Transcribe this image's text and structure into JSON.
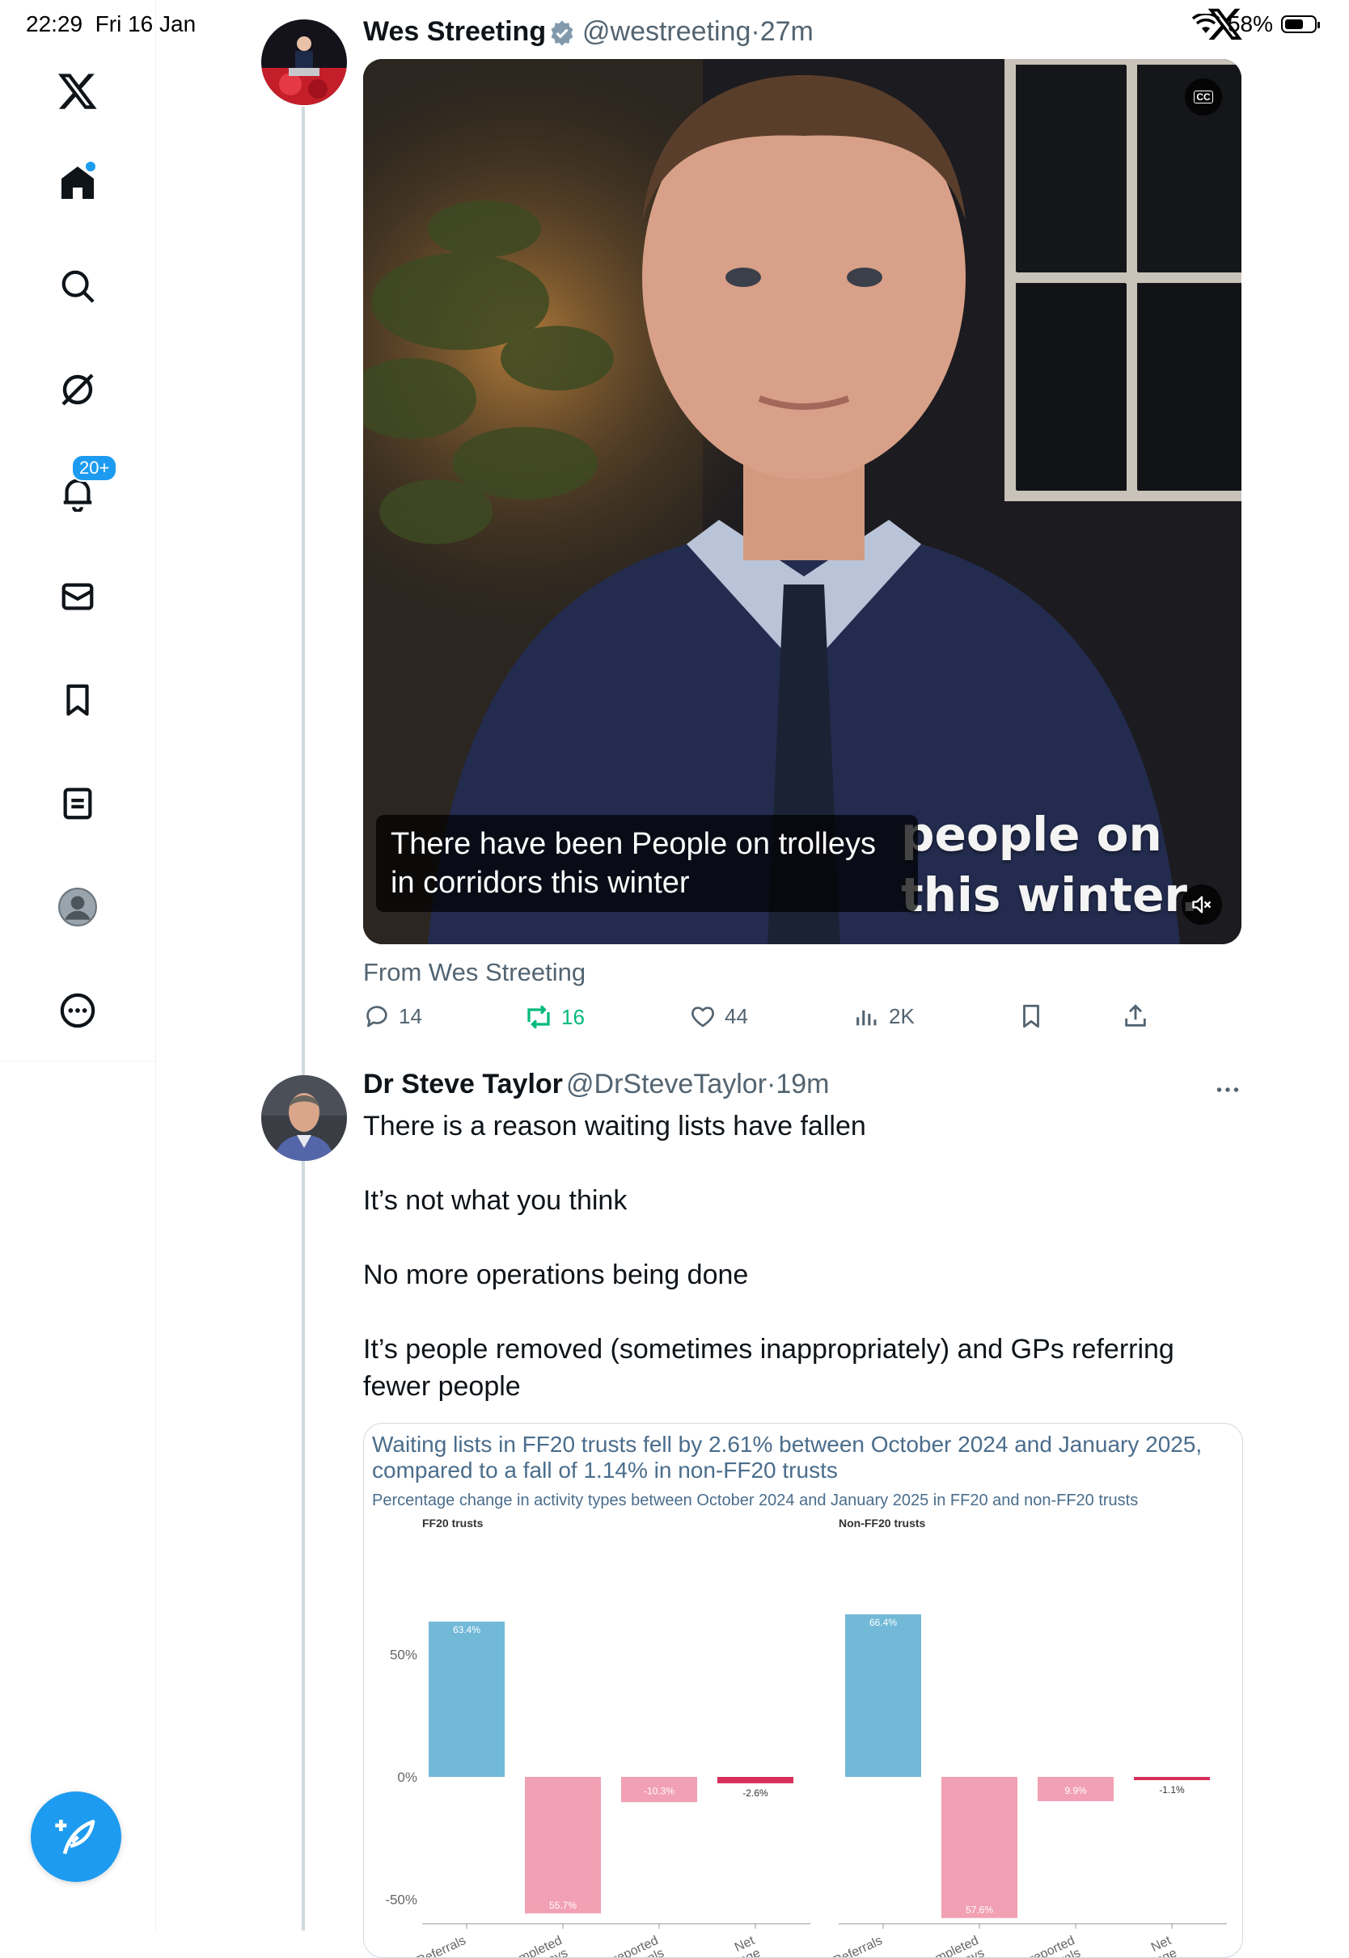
{
  "status_bar": {
    "time": "22:29",
    "date": "Fri 16 Jan",
    "battery": "58%"
  },
  "sidebar": {
    "items": [
      {
        "name": "x-logo",
        "icon": "x-logo-icon"
      },
      {
        "name": "home",
        "icon": "home-icon"
      },
      {
        "name": "search",
        "icon": "search-icon"
      },
      {
        "name": "grok",
        "icon": "grok-icon"
      },
      {
        "name": "notifications",
        "icon": "bell-icon",
        "badge": "20+"
      },
      {
        "name": "messages",
        "icon": "envelope-icon"
      },
      {
        "name": "bookmarks",
        "icon": "bookmark-icon"
      },
      {
        "name": "lists",
        "icon": "list-icon"
      },
      {
        "name": "profile",
        "icon": "avatar-icon"
      },
      {
        "name": "more",
        "icon": "more-circle-icon"
      }
    ],
    "compose_icon": "compose-icon"
  },
  "tweet1": {
    "name": "Wes Streeting",
    "handle": "@westreeting",
    "time": "27m",
    "verified": true,
    "caption_line1": "There have been People on trolleys",
    "caption_line2": "in corridors this winter",
    "burned_caption_1": "people on",
    "burned_caption_2": "this winter.",
    "from": "From Wes Streeting",
    "replies": "14",
    "reposts": "16",
    "likes": "44",
    "views": "2K"
  },
  "tweet2": {
    "name": "Dr Steve Taylor",
    "handle": "@DrSteveTaylor",
    "time": "19m",
    "paragraphs": [
      "There is a reason waiting lists have fallen",
      "It’s not what you think",
      "No more operations being done",
      "It’s people removed (sometimes inappropriately) and GPs referring fewer people"
    ]
  },
  "chart_card": {
    "title": "Waiting lists in FF20 trusts fell by 2.61% between October 2024 and January 2025, compared to a fall of 1.14% in non-FF20 trusts",
    "subtitle": "Percentage change in activity types between October 2024 and January 2025 in FF20 and non-FF20 trusts"
  },
  "chart_data": {
    "type": "bar",
    "categories": [
      "Referrals",
      "Completed pathways",
      "Unreported removals",
      "Net change"
    ],
    "y_ticks": [
      "50%",
      "0%",
      "-50%"
    ],
    "ylim": [
      -55,
      70
    ],
    "colors": {
      "Referrals": "#72b9d8",
      "Completed pathways": "#f2a0b3",
      "Unreported removals": "#f2a0b3",
      "Net change": "#d62f5a"
    },
    "panels": [
      {
        "title": "FF20 trusts",
        "values": [
          63.4,
          -55.7,
          -10.3,
          -2.6
        ],
        "labels": [
          "63.4%",
          "55.7%",
          "-10.3%",
          "-2.6%"
        ]
      },
      {
        "title": "Non-FF20 trusts",
        "values": [
          66.4,
          -57.6,
          -9.9,
          -1.1
        ],
        "labels": [
          "66.4%",
          "57.6%",
          "9.9%",
          "-1.1%"
        ]
      }
    ]
  }
}
